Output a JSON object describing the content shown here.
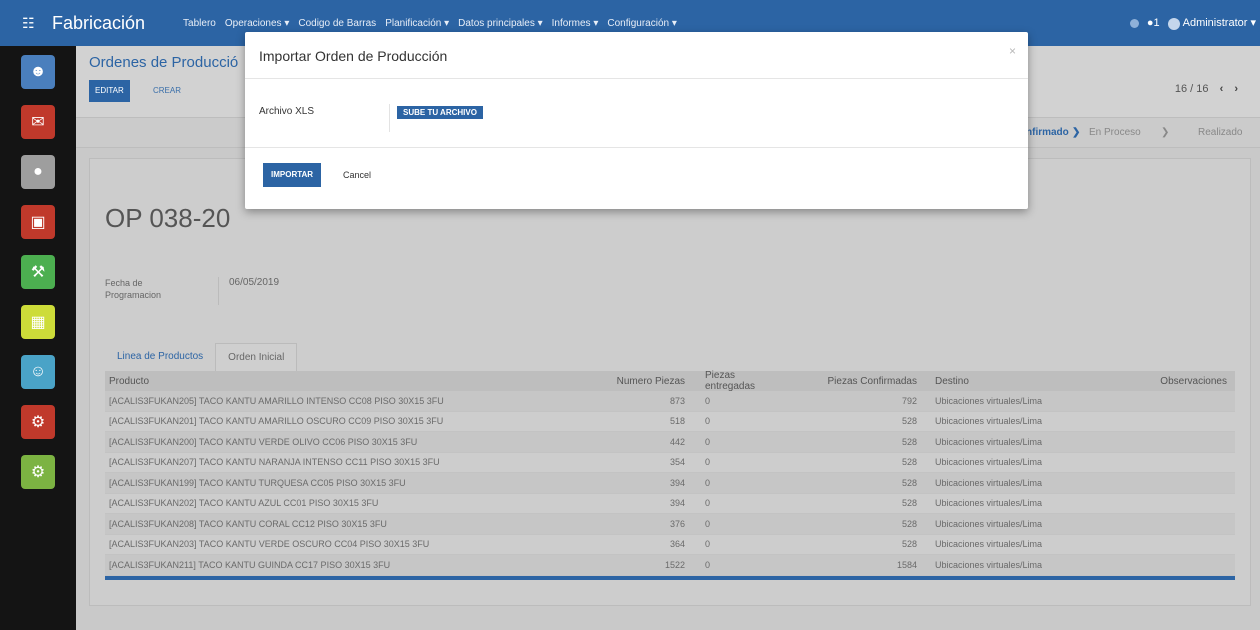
{
  "navbar": {
    "apps_icon": "grid-icon",
    "brand": "Fabricación",
    "menu": [
      "Tablero",
      "Operaciones ▾",
      "Codigo de Barras",
      "Planificación ▾",
      "Datos principales ▾",
      "Informes ▾",
      "Configuración ▾"
    ],
    "messages_count": "1",
    "user": "Administrator ▾"
  },
  "control_panel": {
    "breadcrumb_title": "Ordenes de Producció",
    "edit_label": "EDITAR",
    "create_label": "CREAR",
    "pager": "16 / 16"
  },
  "statusbar": {
    "states": [
      "nfirmado",
      "En Proceso",
      "Realizado"
    ]
  },
  "sheet": {
    "doc_name": "OP 038-20",
    "date_label": "Fecha de Programacion",
    "date_value": "06/05/2019",
    "tabs": [
      "Linea de Productos",
      "Orden Inicial"
    ],
    "columns": [
      "Producto",
      "Numero Piezas",
      "Piezas entregadas",
      "Piezas Confirmadas",
      "Destino",
      "Observaciones"
    ],
    "rows": [
      {
        "producto": "[ACALIS3FUKAN205] TACO KANTU AMARILLO INTENSO CC08 PISO 30X15 3FU",
        "numero": "873",
        "entregadas": "0",
        "confirmadas": "792",
        "destino": "Ubicaciones virtuales/Lima",
        "obs": ""
      },
      {
        "producto": "[ACALIS3FUKAN201] TACO KANTU AMARILLO OSCURO CC09 PISO 30X15 3FU",
        "numero": "518",
        "entregadas": "0",
        "confirmadas": "528",
        "destino": "Ubicaciones virtuales/Lima",
        "obs": ""
      },
      {
        "producto": "[ACALIS3FUKAN200] TACO KANTU VERDE OLIVO CC06 PISO 30X15 3FU",
        "numero": "442",
        "entregadas": "0",
        "confirmadas": "528",
        "destino": "Ubicaciones virtuales/Lima",
        "obs": ""
      },
      {
        "producto": "[ACALIS3FUKAN207] TACO KANTU NARANJA INTENSO CC11 PISO 30X15 3FU",
        "numero": "354",
        "entregadas": "0",
        "confirmadas": "528",
        "destino": "Ubicaciones virtuales/Lima",
        "obs": ""
      },
      {
        "producto": "[ACALIS3FUKAN199] TACO KANTU TURQUESA CC05 PISO 30X15 3FU",
        "numero": "394",
        "entregadas": "0",
        "confirmadas": "528",
        "destino": "Ubicaciones virtuales/Lima",
        "obs": ""
      },
      {
        "producto": "[ACALIS3FUKAN202] TACO KANTU AZUL CC01 PISO 30X15 3FU",
        "numero": "394",
        "entregadas": "0",
        "confirmadas": "528",
        "destino": "Ubicaciones virtuales/Lima",
        "obs": ""
      },
      {
        "producto": "[ACALIS3FUKAN208] TACO KANTU CORAL CC12 PISO 30X15 3FU",
        "numero": "376",
        "entregadas": "0",
        "confirmadas": "528",
        "destino": "Ubicaciones virtuales/Lima",
        "obs": ""
      },
      {
        "producto": "[ACALIS3FUKAN203] TACO KANTU VERDE OSCURO CC04 PISO 30X15 3FU",
        "numero": "364",
        "entregadas": "0",
        "confirmadas": "528",
        "destino": "Ubicaciones virtuales/Lima",
        "obs": ""
      },
      {
        "producto": "[ACALIS3FUKAN211] TACO KANTU GUINDA CC17 PISO 30X15 3FU",
        "numero": "1522",
        "entregadas": "0",
        "confirmadas": "1584",
        "destino": "Ubicaciones virtuales/Lima",
        "obs": ""
      }
    ]
  },
  "modal": {
    "title": "Importar Orden de Producción",
    "close_symbol": "×",
    "field_label": "Archivo XLS",
    "upload_label": "SUBE TU ARCHIVO",
    "import_label": "IMPORTAR",
    "cancel_label": "Cancel"
  },
  "colors": {
    "brand": "#2c64a4",
    "sidebar": "#141414"
  }
}
